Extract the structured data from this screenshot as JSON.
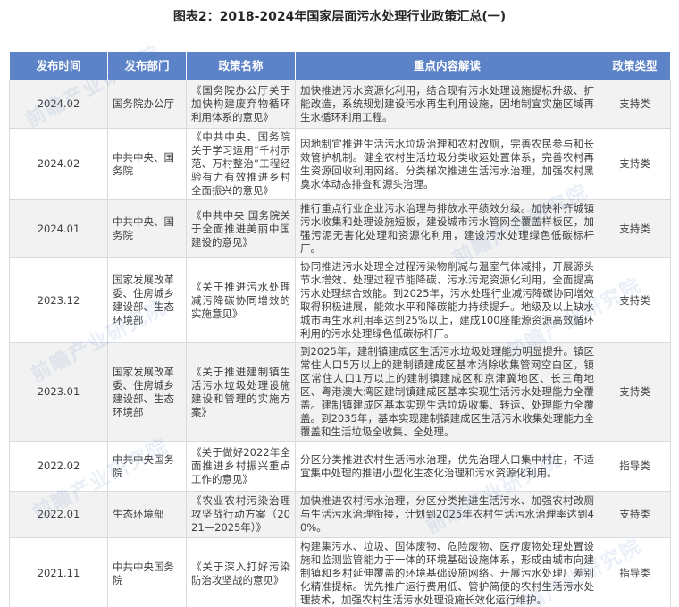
{
  "title": "图表2：2018-2024年国家层面污水处理行业政策汇总(一)",
  "colors": {
    "header_bg": "#5C82C8",
    "row_alt_bg": "#F2F2F2",
    "text": "#3f3f3f",
    "title": "#262626"
  },
  "watermark": {
    "text": "前瞻产业研究院"
  },
  "table": {
    "headers": [
      "发布时间",
      "发布部门",
      "政策名称",
      "重点内容解读",
      "政策类型"
    ],
    "rows": [
      {
        "date": "2024.02",
        "department": "国务院办公厅",
        "policy": "《国务院办公厅关于加快构建废弃物循环利用体系的意见》",
        "content": "加快推进污水资源化利用，结合现有污水处理设施提标升级、扩能改造，系统规划建设污水再生利用设施，因地制宜实施区域再生水循环利用工程。",
        "type": "支持类"
      },
      {
        "date": "2024.02",
        "department": "中共中央、国务院",
        "policy": "《中共中央、国务院关于学习运用“千村示范、万村整治”工程经验有力有效推进乡村全面振兴的意见》",
        "content": "因地制宜推进生活污水垃圾治理和农村改厕，完善农民参与和长效管护机制。健全农村生活垃圾分类收运处置体系，完善农村再生资源回收利用网络。分类梯次推进生活污水治理，加强农村黑臭水体动态排查和源头治理。",
        "type": "支持类"
      },
      {
        "date": "2024.01",
        "department": "中共中央、国务院",
        "policy": "《中共中央 国务院关于全面推进美丽中国建设的意见》",
        "content": "推行重点行业企业污水治理与排放水平绩效分级。加快补齐城镇污水收集和处理设施短板，建设城市污水管网全覆盖样板区，加强污泥无害化处理和资源化利用，建设污水处理绿色低碳标杆厂。",
        "type": "支持类"
      },
      {
        "date": "2023.12",
        "department": "国家发展改革委、住房城乡建设部、生态环境部",
        "policy": "《关于推进污水处理减污降碳协同增效的实施意见》",
        "content": "协同推进污水处理全过程污染物削减与温室气体减排，开展源头节水增效、处理过程节能降碳、污水污泥资源化利用，全面提高污水处理综合效能。到2025年，污水处理行业减污降碳协同增效取得积极进展，能效水平和降碳能力持续提升。地级及以上缺水城市再生水利用率达到25%以上，建成100座能源资源高效循环利用的污水处理绿色低碳标杆厂。",
        "type": "支持类"
      },
      {
        "date": "2023.01",
        "department": "国家发展改革委、住房城乡建设部、生态环境部",
        "policy": "《关于推进建制镇生活污水垃圾处理设施建设和管理的实施方案》",
        "content": "到2025年，建制镇建成区生活污水垃圾处理能力明显提升。镇区常住人口5万以上的建制镇建成区基本消除收集管网空白区，镇区常住人口1万以上的建制镇建成区和京津冀地区、长三角地区、粤港澳大湾区建制镇建成区基本实现生活污水处理能力全覆盖。建制镇建成区基本实现生活垃圾收集、转运、处理能力全覆盖。到2035年，基本实现建制镇建成区生活污水收集处理能力全覆盖和生活垃圾全收集、全处理。",
        "type": "支持类"
      },
      {
        "date": "2022.02",
        "department": "中共中央国务院",
        "policy": "《关于做好2022年全面推进乡村振兴重点工作的意见》",
        "content": "分区分类推进农村生活污水治理，优先治理人口集中村庄，不适宜集中处理的推进小型化生态化治理和污水资源化利用。",
        "type": "指导类"
      },
      {
        "date": "2022.01",
        "department": "生态环境部",
        "policy": "《农业农村污染治理攻坚战行动方案（2021—2025年）》",
        "content": "加快推进农村污水治理，分区分类推进生活污水、加强农村改厕与生活污水治理衔接，计划到2025年农村生活污水治理率达到40%。",
        "type": "支持类"
      },
      {
        "date": "2021.11",
        "department": "中共中央国务院",
        "policy": "《关于深入打好污染防治攻坚战的意见》",
        "content": "构建集污水、垃圾、固体废物、危险废物、医疗废物处理处置设施和监测监管能力于一体的环境基础设施体系，形成由城市向建制镇和乡村延伸覆盖的环境基础设施网络。开展污水处理厂差别化精准提标。优先推广运行费用低、管护简便的农村生活污水处理技术，加强农村生活污水处理设施长效化运行维护。",
        "type": "指导类"
      }
    ]
  }
}
